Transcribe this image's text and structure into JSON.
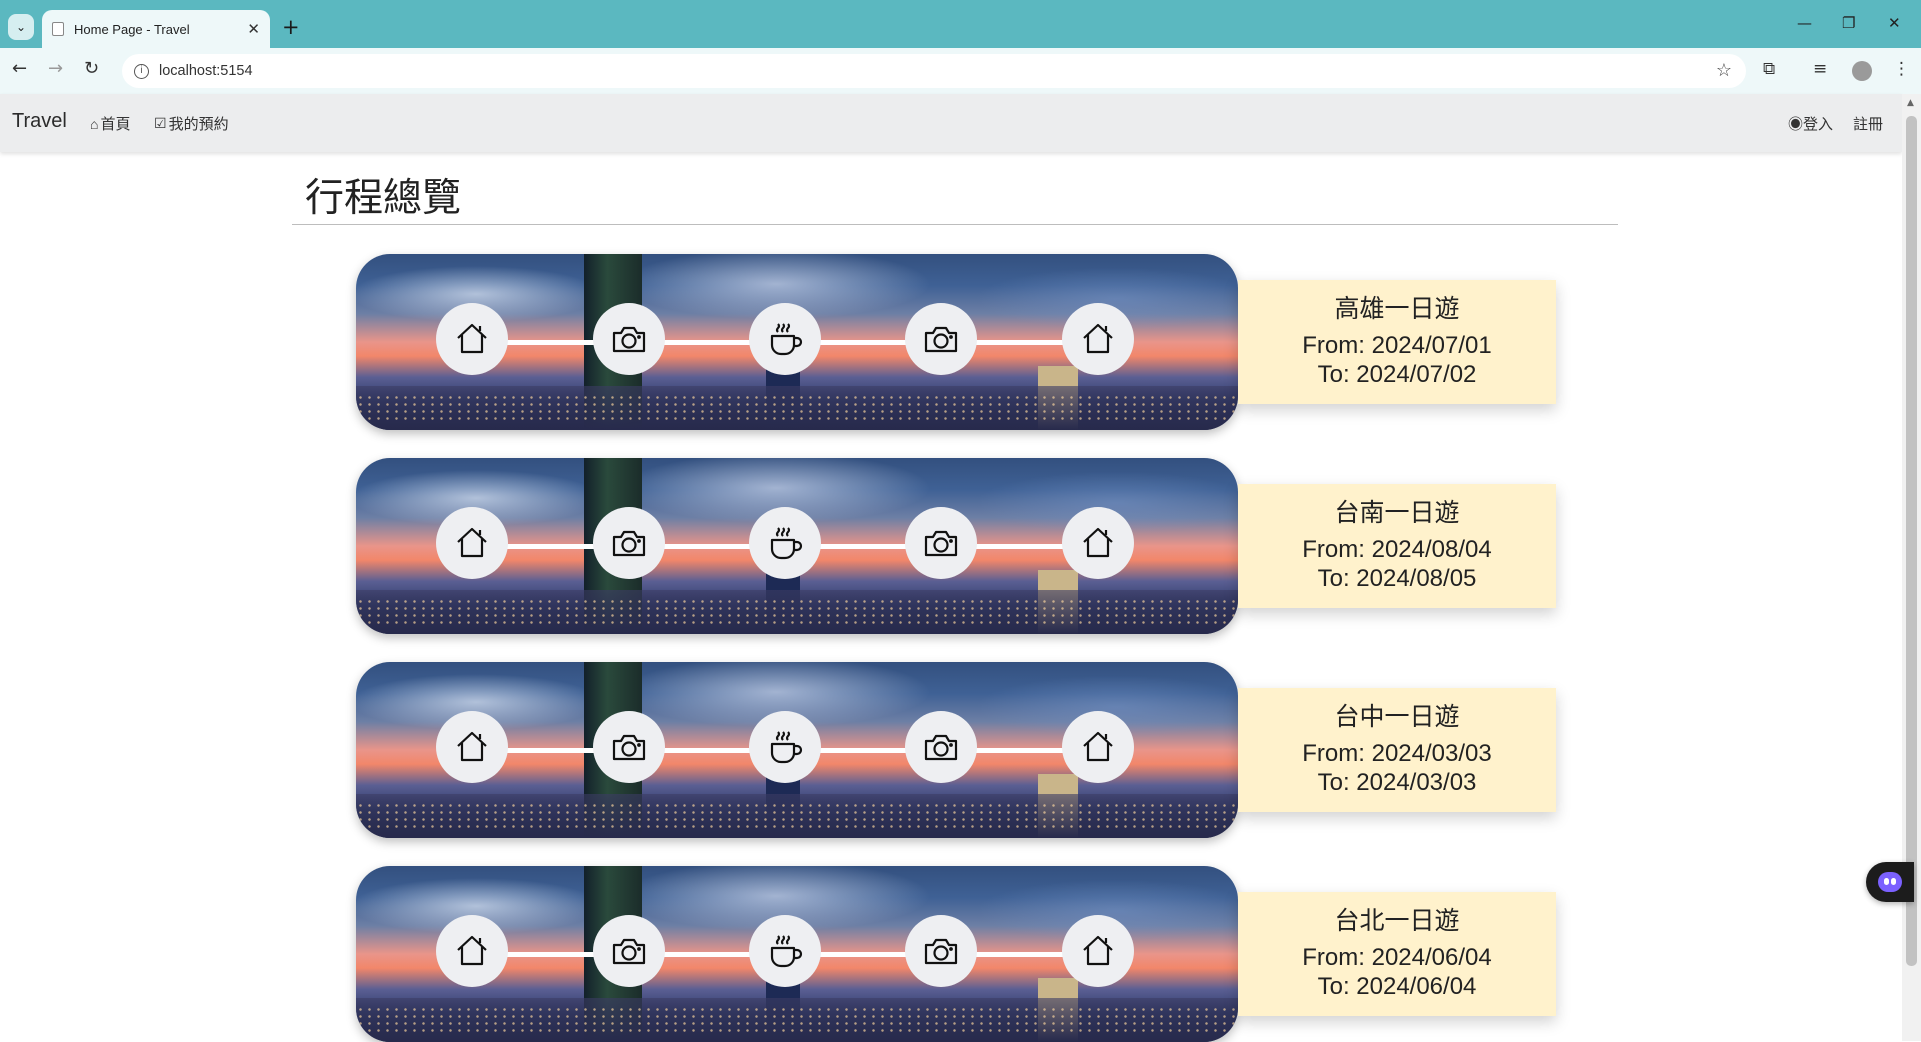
{
  "browser": {
    "tab_title": "Home Page - Travel",
    "tab_close": "✕",
    "new_tab": "+",
    "url": "localhost:5154",
    "win_min": "—",
    "win_restore": "❐",
    "win_close": "✕"
  },
  "nav": {
    "brand": "Travel",
    "home": "首頁",
    "my_bookings": "我的預約",
    "login": "登入",
    "register": "註冊"
  },
  "page": {
    "title": "行程總覽"
  },
  "trips": [
    {
      "name": "高雄一日遊",
      "from": "From: 2024/07/01",
      "to": "To: 2024/07/02"
    },
    {
      "name": "台南一日遊",
      "from": "From: 2024/08/04",
      "to": "To: 2024/08/05"
    },
    {
      "name": "台中一日遊",
      "from": "From: 2024/03/03",
      "to": "To: 2024/03/03"
    },
    {
      "name": "台北一日遊",
      "from": "From: 2024/06/04",
      "to": "To: 2024/06/04"
    }
  ],
  "stop_icons": [
    "house-icon",
    "camera-icon",
    "coffee-icon",
    "camera-icon",
    "house-icon"
  ],
  "colors": {
    "browser_frame": "#5bb8c0",
    "toolbar": "#eef8f9",
    "navbar": "#ecedee",
    "card_bg": "#fff2cc"
  }
}
